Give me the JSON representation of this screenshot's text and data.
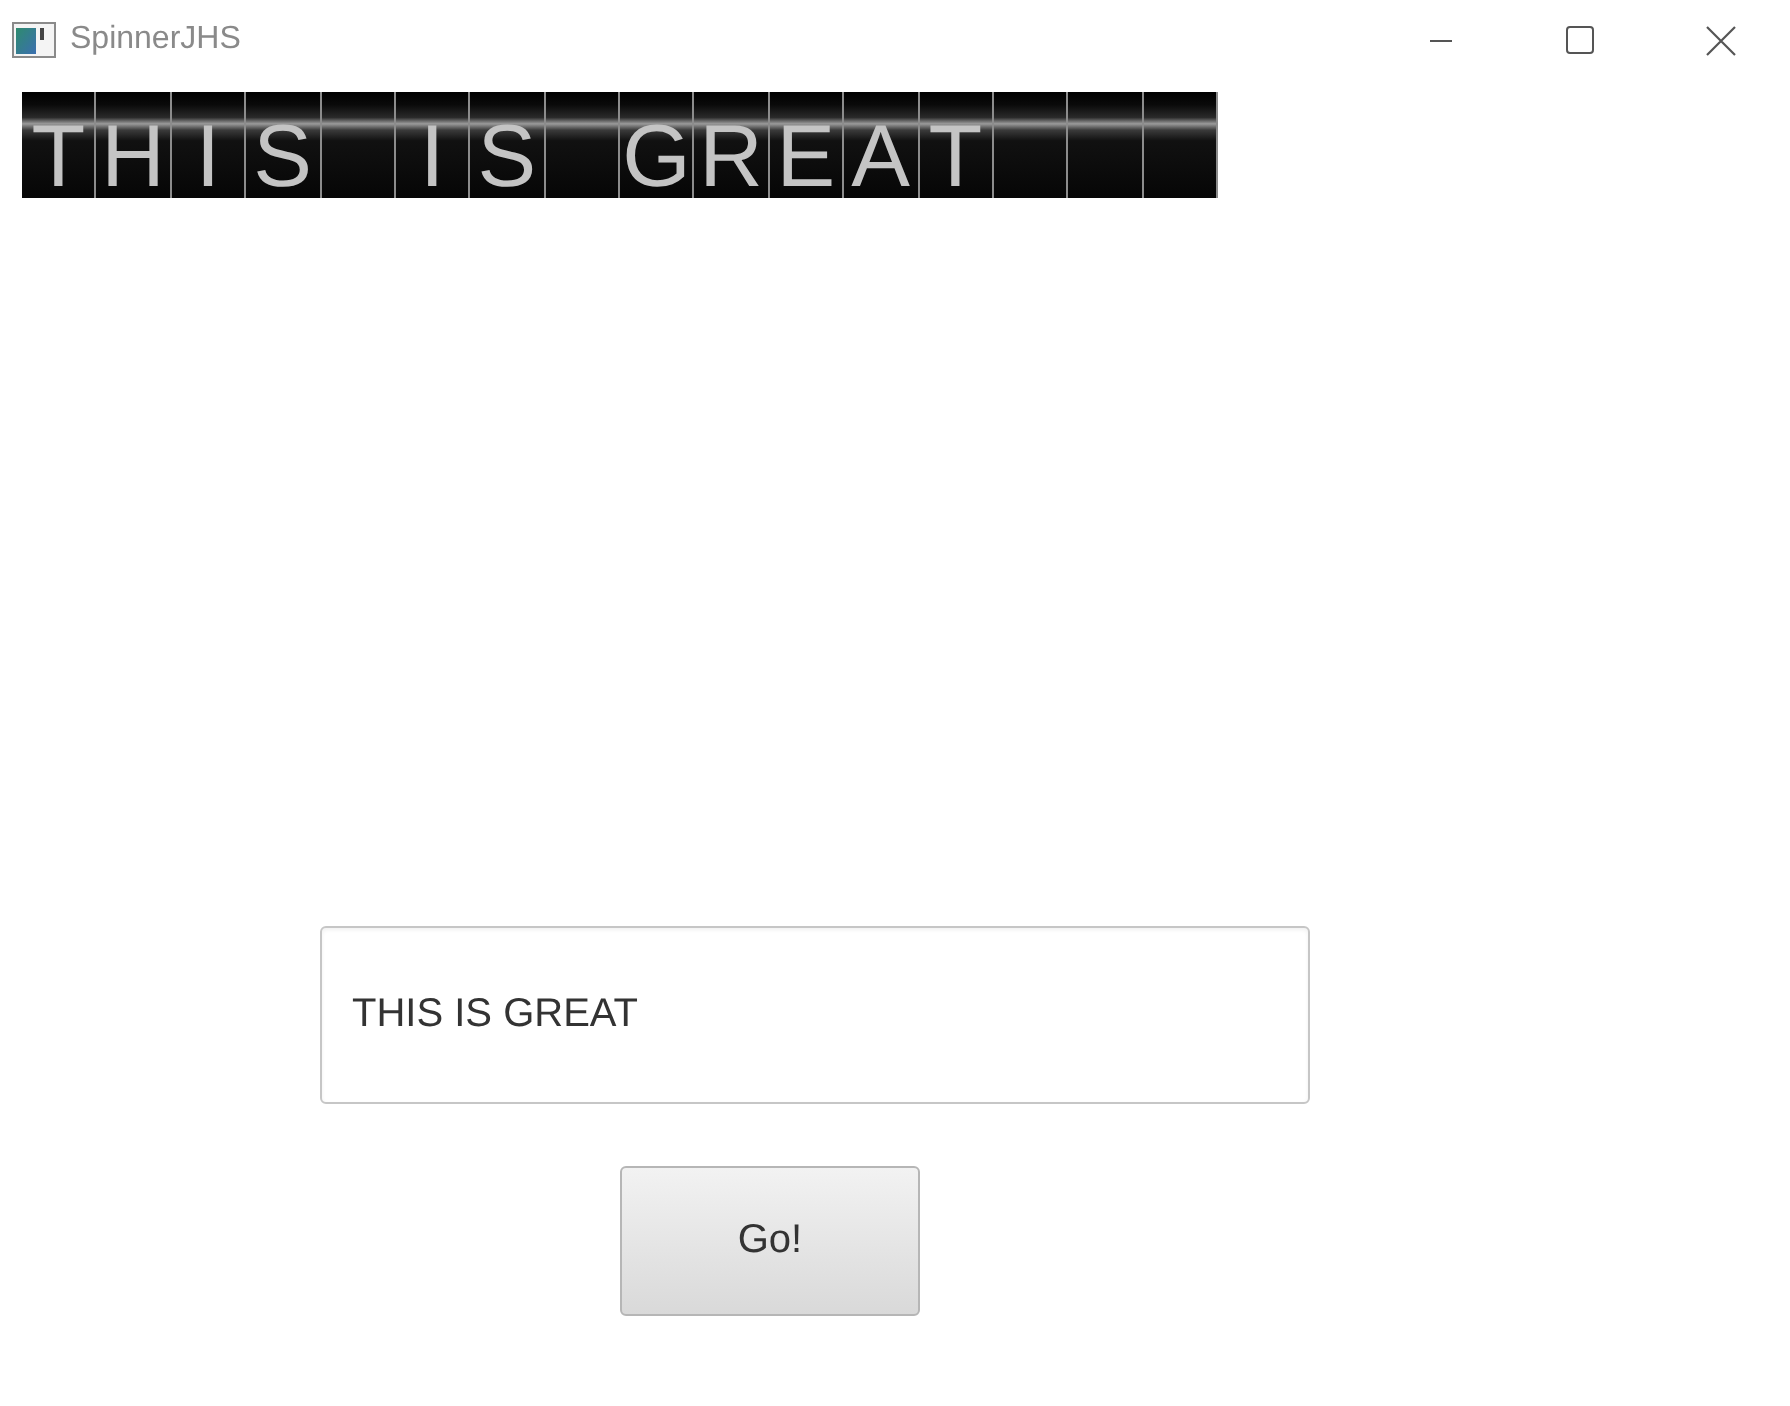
{
  "window": {
    "title": "SpinnerJHS"
  },
  "flap_display": {
    "tiles": [
      {
        "kind": "letter",
        "char": "T"
      },
      {
        "kind": "letter",
        "char": "H"
      },
      {
        "kind": "letter",
        "char": "I"
      },
      {
        "kind": "letter",
        "char": "S"
      },
      {
        "kind": "blank"
      },
      {
        "kind": "letter",
        "char": "I"
      },
      {
        "kind": "letter",
        "char": "S"
      },
      {
        "kind": "blank"
      },
      {
        "kind": "letter",
        "char": "G"
      },
      {
        "kind": "letter",
        "char": "R"
      },
      {
        "kind": "letter",
        "char": "E"
      },
      {
        "kind": "letter",
        "char": "A"
      },
      {
        "kind": "letter",
        "char": "T"
      },
      {
        "kind": "blank"
      },
      {
        "kind": "blank"
      },
      {
        "kind": "blank"
      }
    ]
  },
  "text_field": {
    "value": "THIS IS GREAT"
  },
  "buttons": [
    {
      "label": "Go!"
    }
  ]
}
